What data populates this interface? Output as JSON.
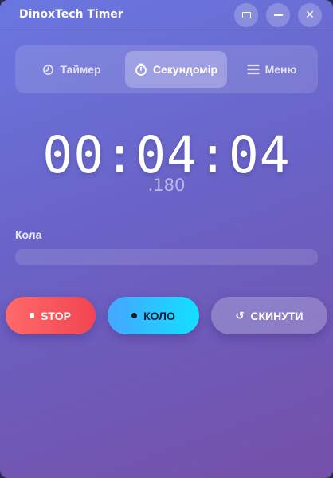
{
  "window": {
    "title": "DinoxTech Timer"
  },
  "tabs": [
    {
      "label": "Таймер",
      "icon": "timer-icon",
      "active": false
    },
    {
      "label": "Секундомір",
      "icon": "stopwatch-icon",
      "active": true
    },
    {
      "label": "Меню",
      "icon": "menu-icon",
      "active": false
    }
  ],
  "stopwatch": {
    "time": "00:04:04",
    "milliseconds": ".180"
  },
  "laps": {
    "label": "Кола",
    "items": []
  },
  "actions": {
    "stop": {
      "label": "STOP",
      "icon": "stop-icon",
      "color": "#f04552"
    },
    "lap": {
      "label": "КОЛО",
      "icon": "dot-icon",
      "color": "#12e0ff"
    },
    "reset": {
      "label": "СКИНУТИ",
      "icon": "reset-icon"
    }
  },
  "colors": {
    "accent_start": "#6a77e0",
    "accent_end": "#7550a8"
  }
}
